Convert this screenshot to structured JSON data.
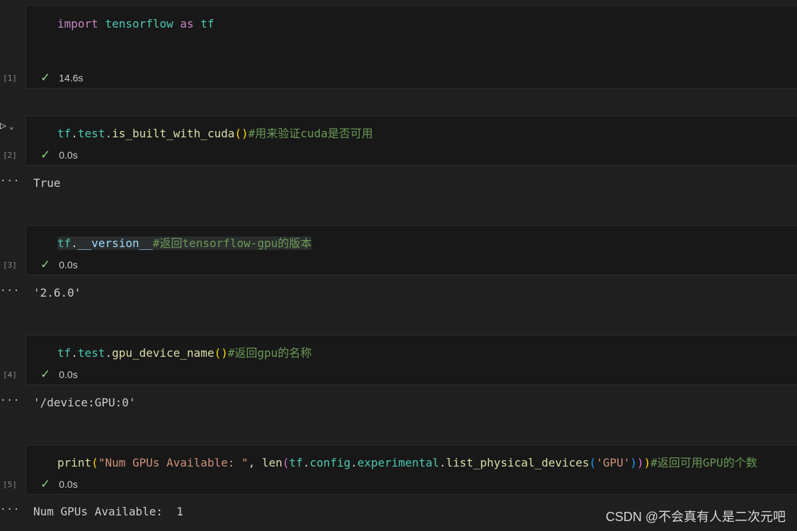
{
  "cells": [
    {
      "exec": "[1]",
      "code_tokens": [
        {
          "t": "import",
          "c": "kw"
        },
        {
          "t": " ",
          "c": "plain"
        },
        {
          "t": "tensorflow",
          "c": "mod"
        },
        {
          "t": " ",
          "c": "plain"
        },
        {
          "t": "as",
          "c": "kw"
        },
        {
          "t": " ",
          "c": "plain"
        },
        {
          "t": "tf",
          "c": "mod"
        }
      ],
      "time": "14.6s",
      "output": null
    },
    {
      "exec": "[2]",
      "code_tokens": [
        {
          "t": "tf",
          "c": "mod"
        },
        {
          "t": ".",
          "c": "plain"
        },
        {
          "t": "test",
          "c": "mod"
        },
        {
          "t": ".",
          "c": "plain"
        },
        {
          "t": "is_built_with_cuda",
          "c": "fn"
        },
        {
          "t": "()",
          "c": "pb1"
        },
        {
          "t": "#用来验证cuda是否可用",
          "c": "cm"
        }
      ],
      "time": "0.0s",
      "output": "True"
    },
    {
      "exec": "[3]",
      "code_tokens": [
        {
          "t": "tf",
          "c": "mod"
        },
        {
          "t": ".",
          "c": "plain"
        },
        {
          "t": "__version__",
          "c": "var"
        },
        {
          "t": "#返回tensorflow-gpu的版本",
          "c": "cm"
        }
      ],
      "time": "0.0s",
      "output": "'2.6.0'"
    },
    {
      "exec": "[4]",
      "code_tokens": [
        {
          "t": "tf",
          "c": "mod"
        },
        {
          "t": ".",
          "c": "plain"
        },
        {
          "t": "test",
          "c": "mod"
        },
        {
          "t": ".",
          "c": "plain"
        },
        {
          "t": "gpu_device_name",
          "c": "fn"
        },
        {
          "t": "()",
          "c": "pb1"
        },
        {
          "t": "#返回gpu的名称",
          "c": "cm"
        }
      ],
      "time": "0.0s",
      "output": "'/device:GPU:0'"
    },
    {
      "exec": "[5]",
      "code_tokens": [
        {
          "t": "print",
          "c": "fn"
        },
        {
          "t": "(",
          "c": "pb1"
        },
        {
          "t": "\"Num GPUs Available: \"",
          "c": "str"
        },
        {
          "t": ", ",
          "c": "plain"
        },
        {
          "t": "len",
          "c": "fn"
        },
        {
          "t": "(",
          "c": "pb2"
        },
        {
          "t": "tf",
          "c": "mod"
        },
        {
          "t": ".",
          "c": "plain"
        },
        {
          "t": "config",
          "c": "mod"
        },
        {
          "t": ".",
          "c": "plain"
        },
        {
          "t": "experimental",
          "c": "mod"
        },
        {
          "t": ".",
          "c": "plain"
        },
        {
          "t": "list_physical_devices",
          "c": "fn"
        },
        {
          "t": "(",
          "c": "pb3"
        },
        {
          "t": "'GPU'",
          "c": "str"
        },
        {
          "t": ")",
          "c": "pb3"
        },
        {
          "t": ")",
          "c": "pb2"
        },
        {
          "t": ")",
          "c": "pb1"
        },
        {
          "t": "#返回可用GPU的个数",
          "c": "cm"
        }
      ],
      "time": "0.0s",
      "output": "Num GPUs Available:  1"
    }
  ],
  "watermark": "CSDN @不会真有人是二次元吧",
  "icons": {
    "run": "play-icon",
    "expand": "chevron-down-icon",
    "status": "check-icon",
    "output_menu": "ellipsis-icon"
  },
  "colors": {
    "success": "#89d185",
    "background": "#1f1f1f",
    "cell_background": "#181818"
  }
}
